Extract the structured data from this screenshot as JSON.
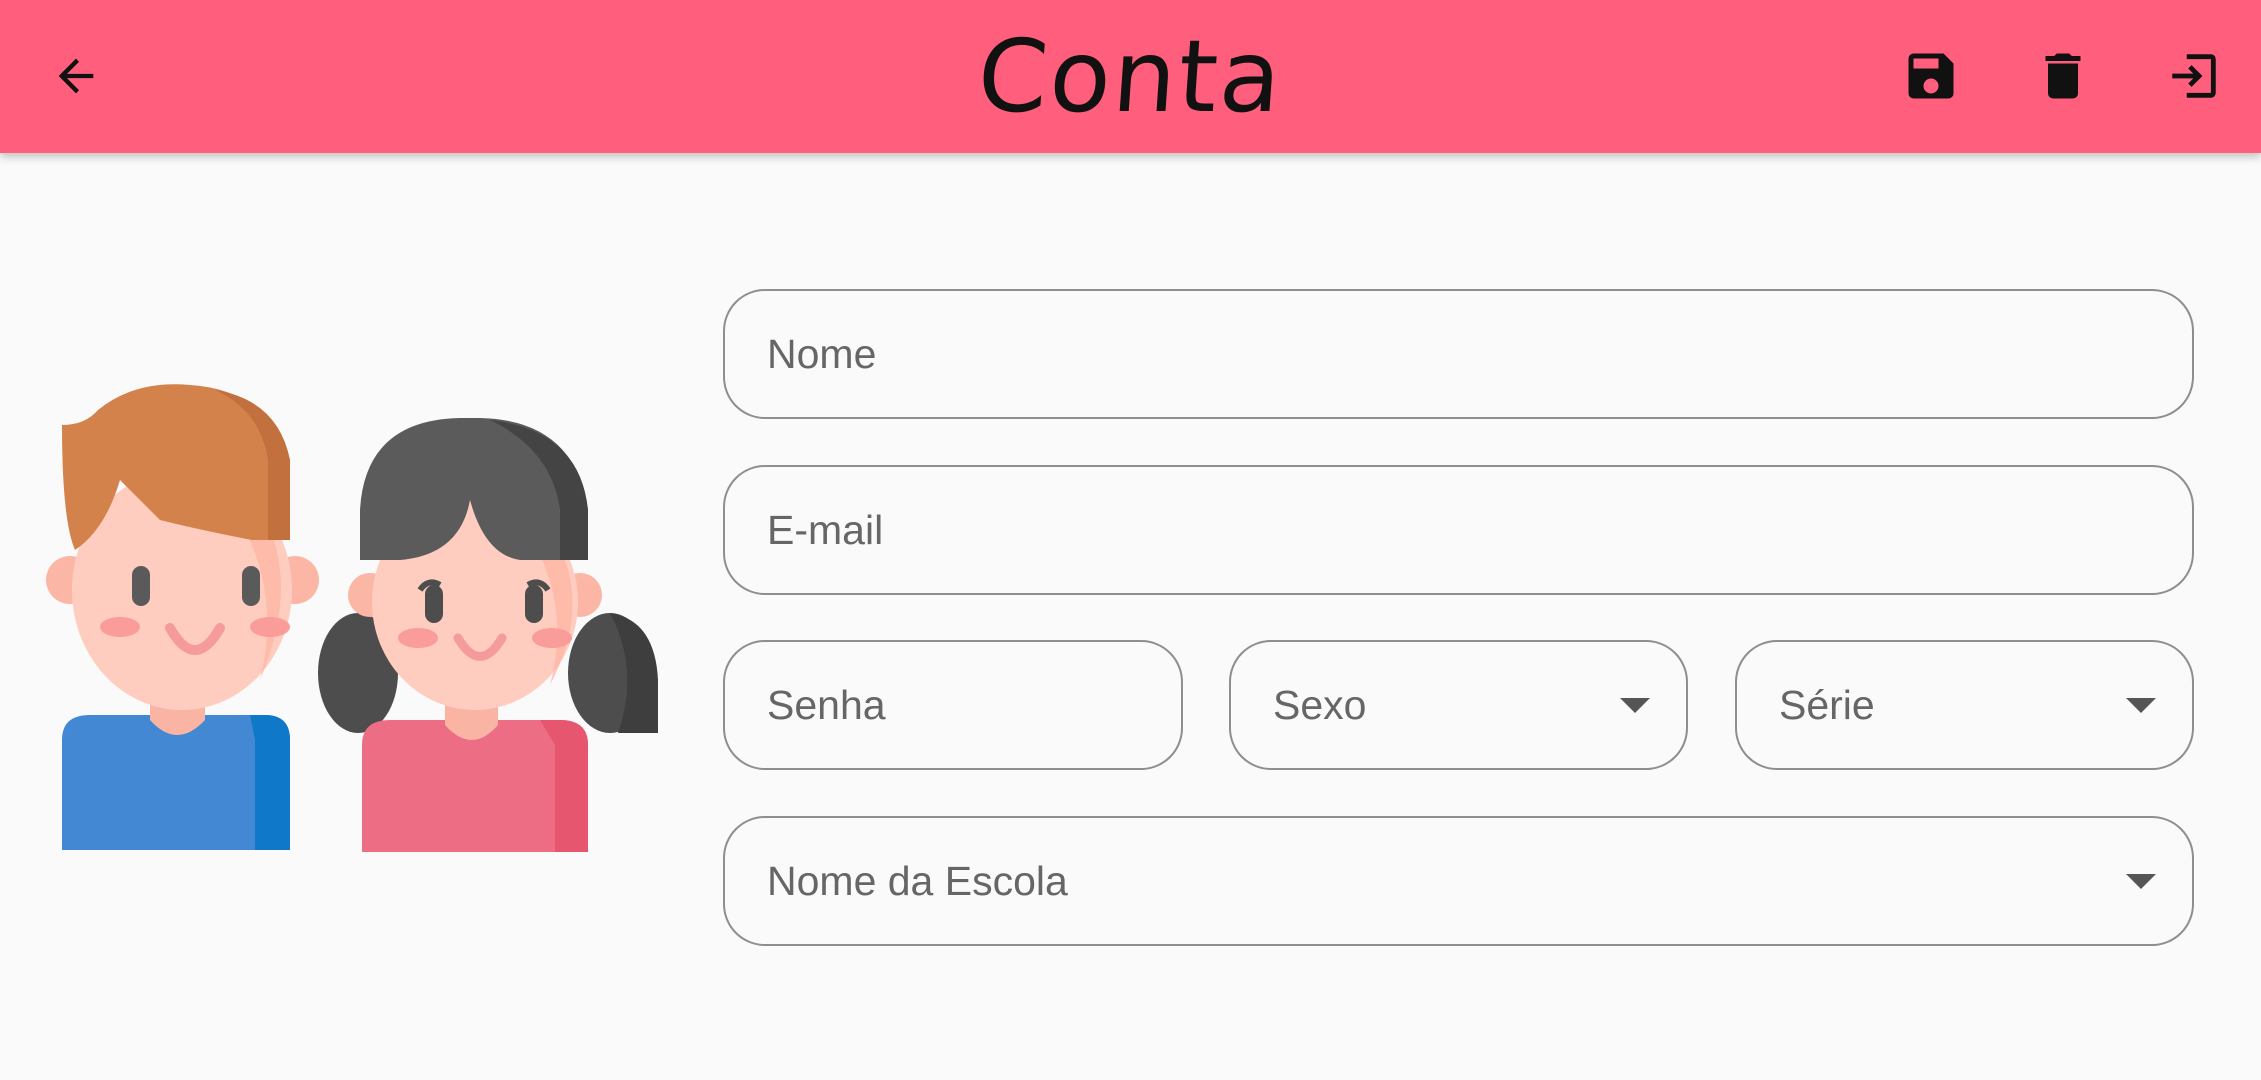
{
  "appbar": {
    "title": "Conta",
    "color": "#ff5f7c",
    "icons": {
      "back": "arrow-back-icon",
      "save": "floppy-save-icon",
      "delete": "trash-icon",
      "exit": "logout-icon"
    }
  },
  "illustration": {
    "name": "two-children-avatars"
  },
  "form": {
    "nome": {
      "label": "Nome",
      "value": ""
    },
    "email": {
      "label": "E-mail",
      "value": ""
    },
    "senha": {
      "label": "Senha",
      "value": ""
    },
    "sexo": {
      "label": "Sexo",
      "selected": ""
    },
    "serie": {
      "label": "Série",
      "selected": ""
    },
    "escola": {
      "label": "Nome da Escola",
      "selected": ""
    }
  }
}
